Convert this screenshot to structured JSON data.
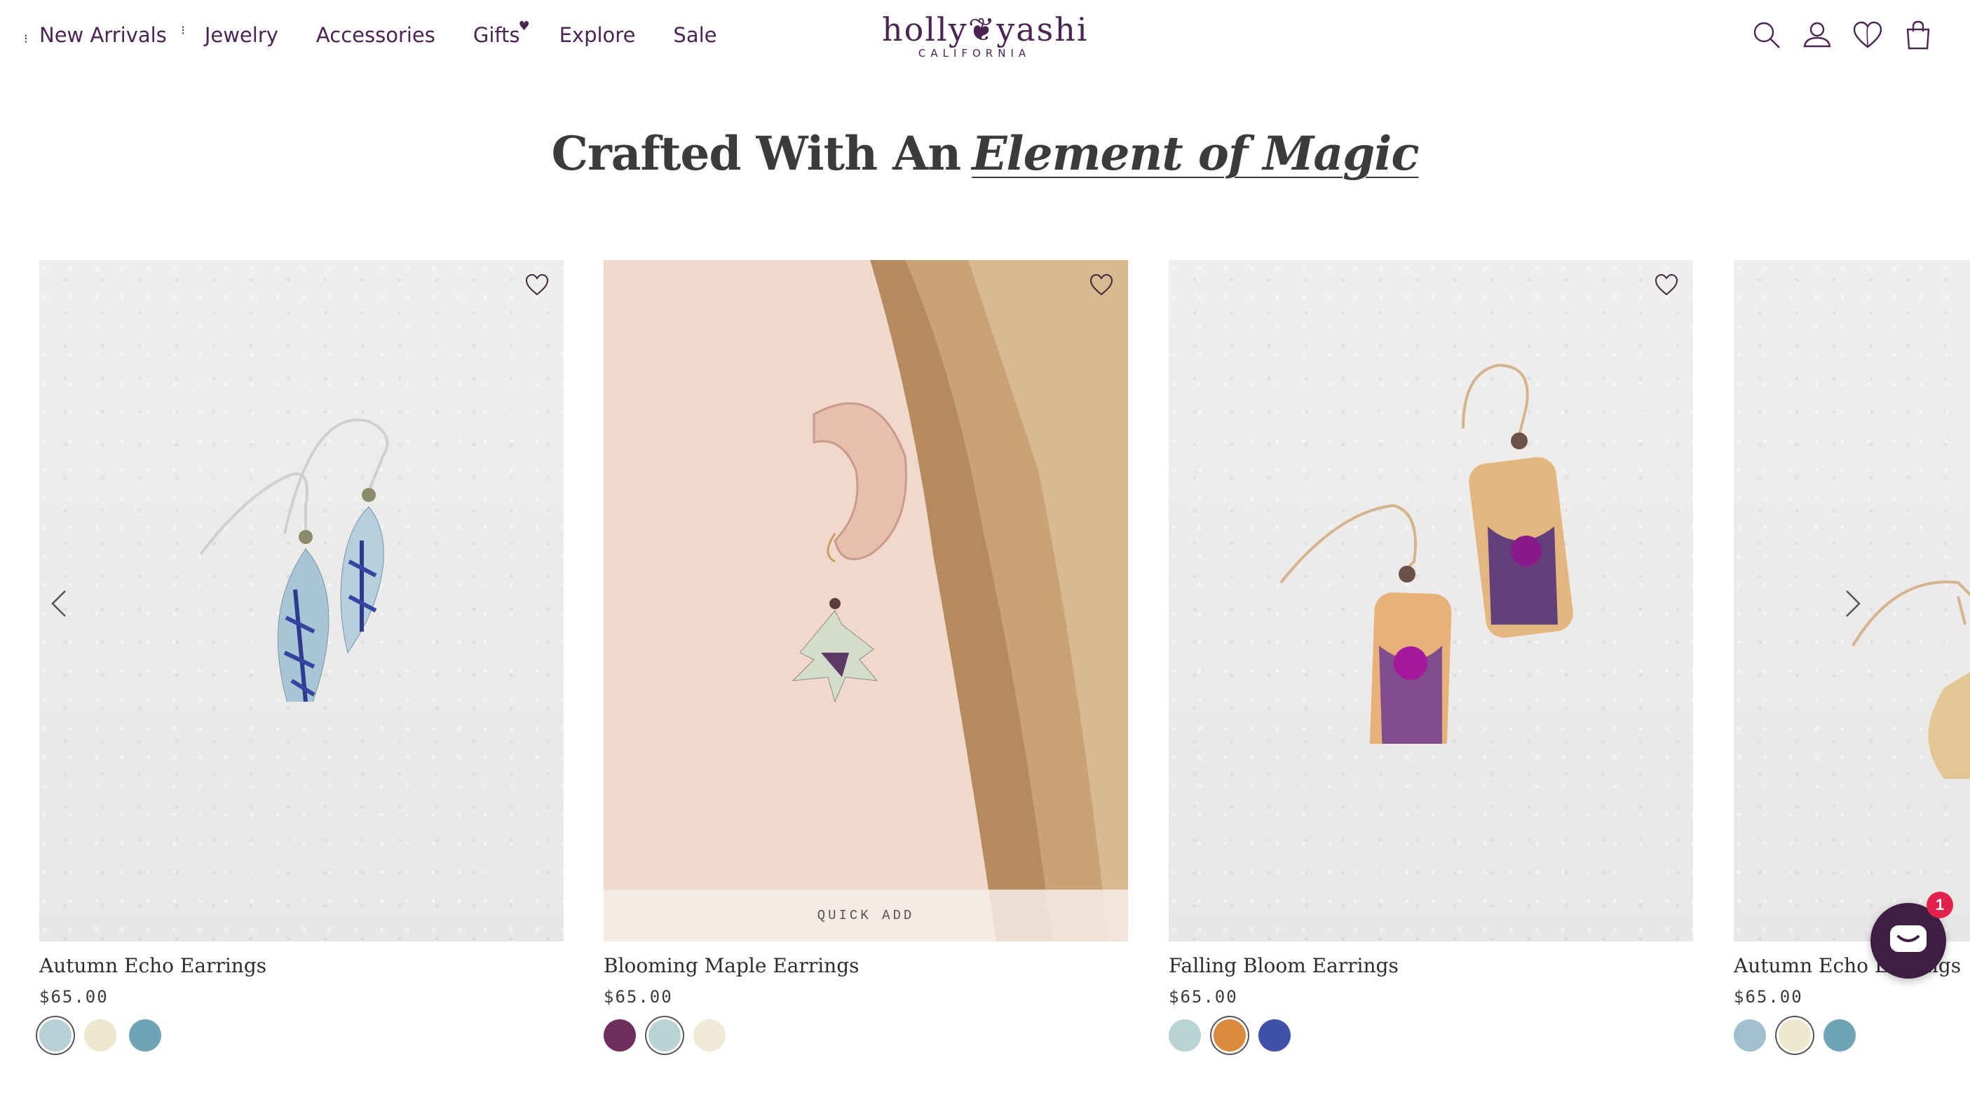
{
  "nav": {
    "items": [
      {
        "label": "New Arrivals"
      },
      {
        "label": "Jewelry"
      },
      {
        "label": "Accessories"
      },
      {
        "label": "Gifts"
      },
      {
        "label": "Explore"
      },
      {
        "label": "Sale"
      }
    ]
  },
  "logo": {
    "main": "holly❦yashi",
    "sub": "CALIFORNIA"
  },
  "header_icons": [
    "search-icon",
    "account-icon",
    "wishlist-heart-icon",
    "cart-bag-icon"
  ],
  "headline": {
    "prefix": "Crafted With An",
    "accent": "Element of Magic"
  },
  "products": [
    {
      "name": "Autumn Echo Earrings",
      "price": "$65.00",
      "swatches": [
        "#b9cfd6",
        "#efe6cf",
        "#6fa3b6"
      ],
      "selected_swatch": 0
    },
    {
      "name": "Blooming Maple Earrings",
      "price": "$65.00",
      "quick_add": "QUICK ADD",
      "swatches": [
        "#6e2e5b",
        "#b9d4d6",
        "#f1e8d6"
      ],
      "selected_swatch": 1
    },
    {
      "name": "Falling Bloom Earrings",
      "price": "$65.00",
      "swatches": [
        "#b7d3d6",
        "#d98a3d",
        "#3f52a8"
      ],
      "selected_swatch": 1
    },
    {
      "name": "Autumn Echo Earrings",
      "price": "$65.00",
      "swatches": [
        "#9fc0cc",
        "#efe6cf",
        "#6fa3b6"
      ],
      "selected_swatch": 1
    }
  ],
  "chat": {
    "badge": "1"
  },
  "colors": {
    "brand_purple": "#4a2452",
    "badge_red": "#e3224b"
  }
}
